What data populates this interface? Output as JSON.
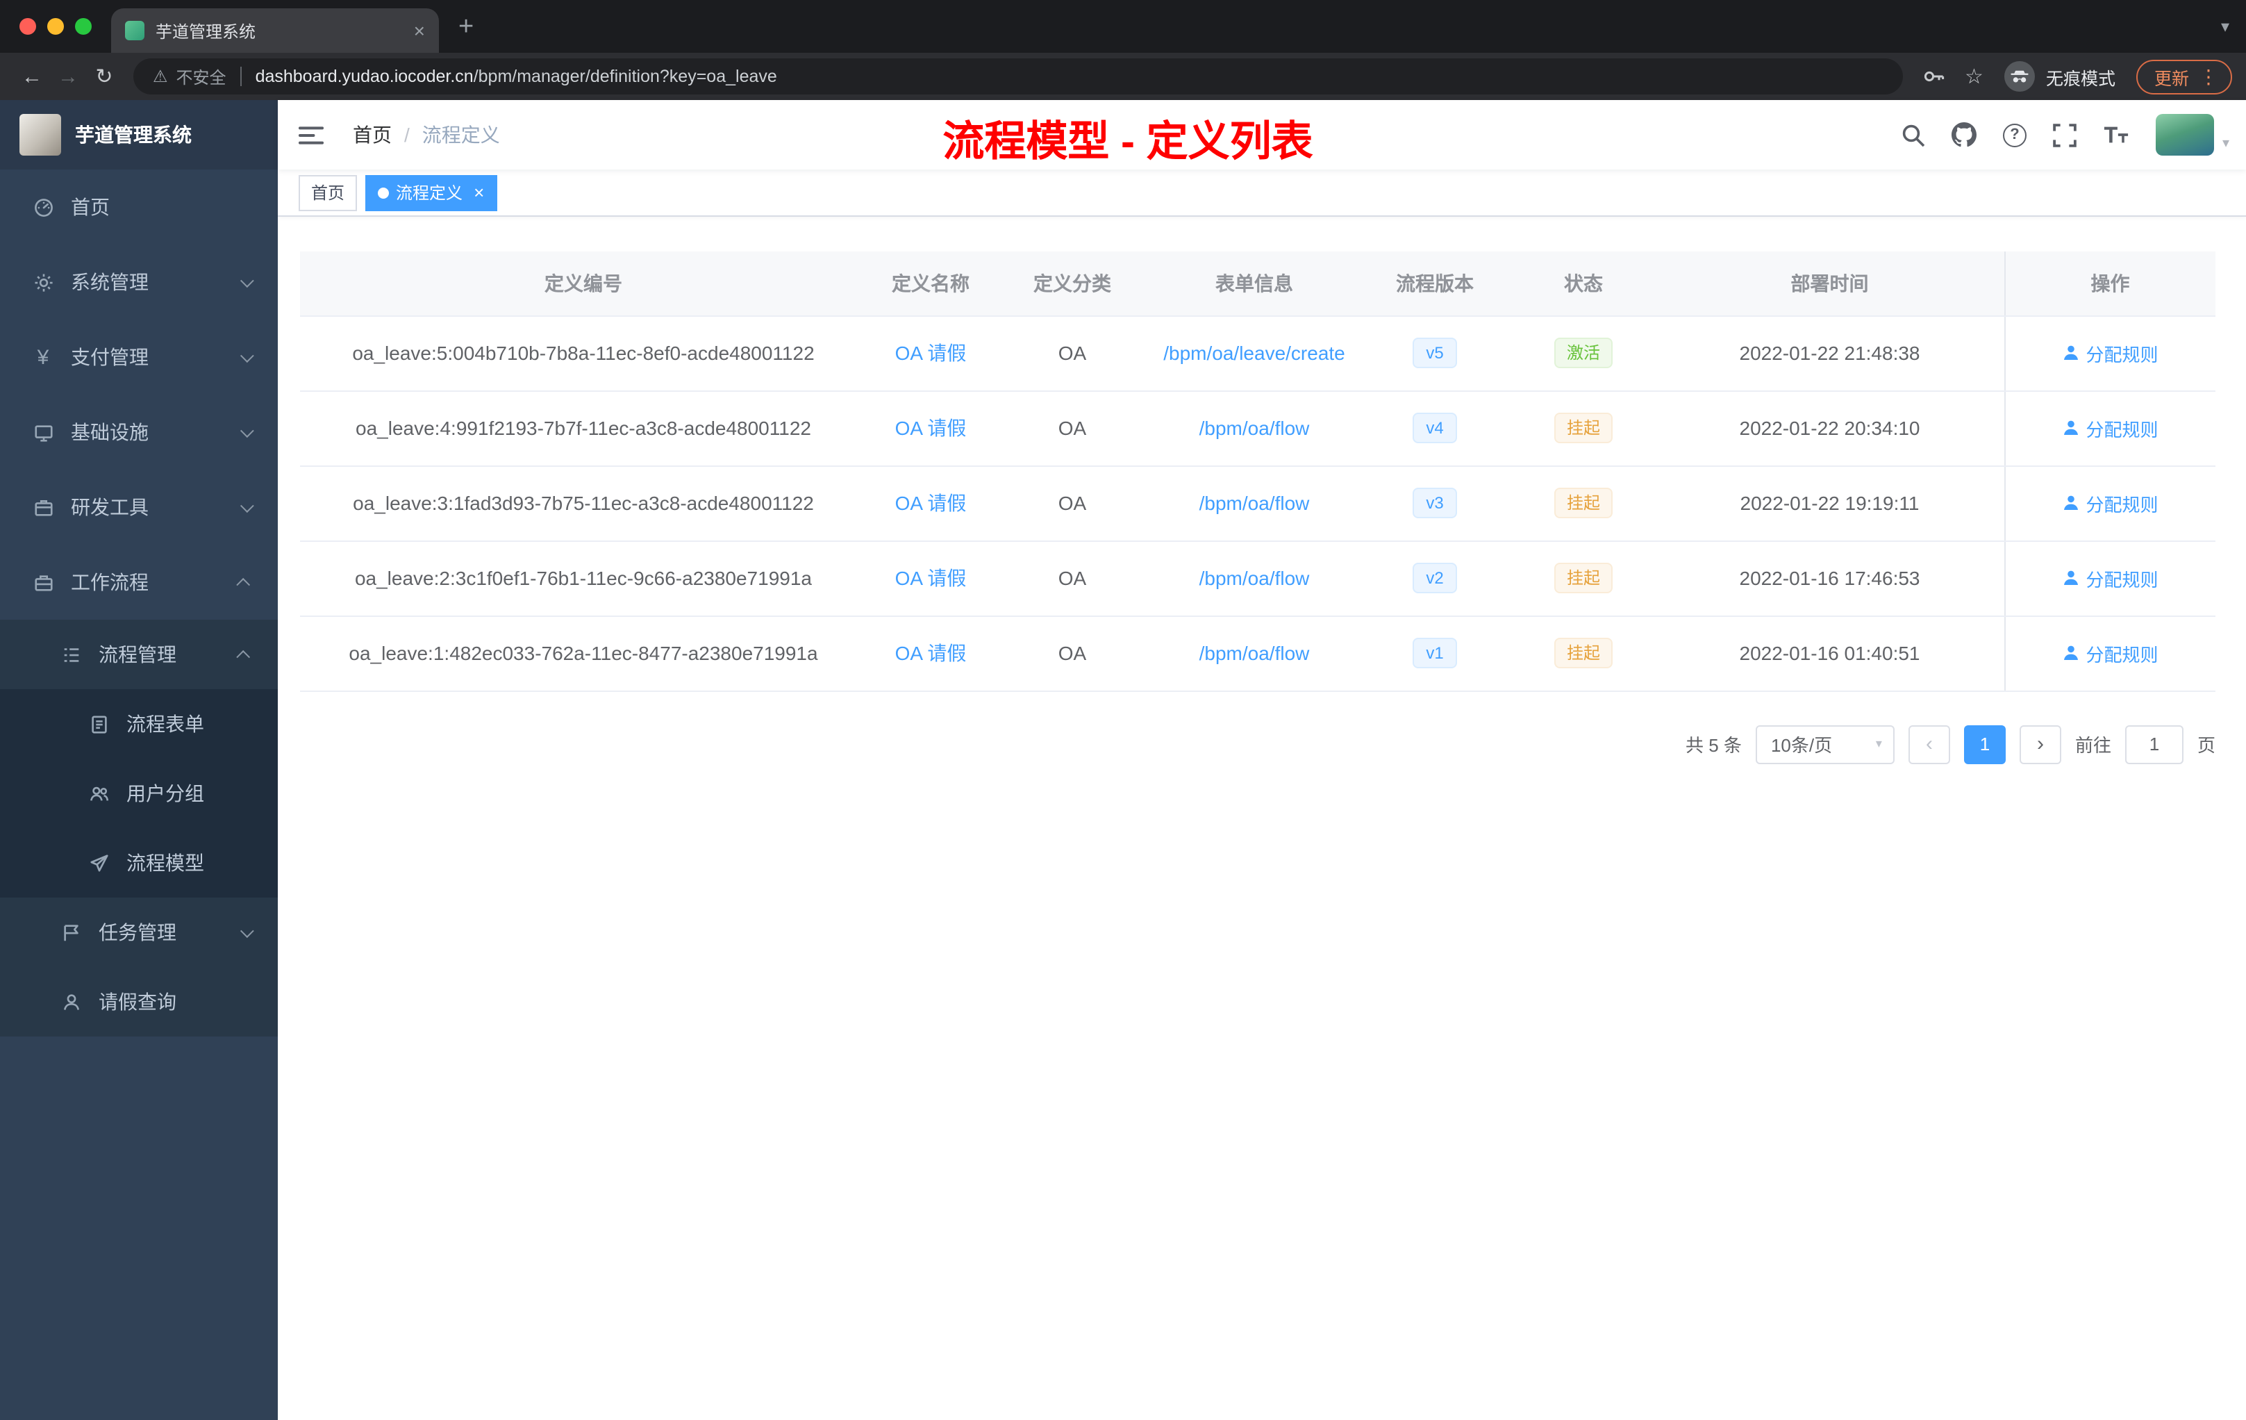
{
  "colors": {
    "accent": "#409eff",
    "success": "#67c23a",
    "warning": "#e6a23c",
    "annotation_red": "#fe0000",
    "sidebar_bg": "#304156"
  },
  "icons": {
    "back": "←",
    "forward": "→",
    "reload": "↻",
    "star": "☆",
    "warning": "⚠",
    "plus": "+",
    "close": "×",
    "chevron_down": "▾",
    "caret_down": "▾",
    "dots": "⋮",
    "question": "?",
    "prev": "‹",
    "next": "›",
    "yen": "¥"
  },
  "browser": {
    "tab_title": "芋道管理系统",
    "security_label": "不安全",
    "url_host": "dashboard.yudao.iocoder.cn",
    "url_path": "/bpm/manager/definition?key=oa_leave",
    "incognito_label": "无痕模式",
    "update_label": "更新"
  },
  "sidebar": {
    "logo_title": "芋道管理系统",
    "items": {
      "home": "首页",
      "system": "系统管理",
      "payment": "支付管理",
      "infra": "基础设施",
      "devtools": "研发工具",
      "workflow": "工作流程",
      "process_mgmt": "流程管理",
      "process_form": "流程表单",
      "user_group": "用户分组",
      "process_model": "流程模型",
      "task_mgmt": "任务管理",
      "leave_query": "请假查询"
    }
  },
  "navbar": {
    "breadcrumb_home": "首页",
    "breadcrumb_sep": "/",
    "breadcrumb_current": "流程定义",
    "annotation": "流程模型 - 定义列表"
  },
  "tags": {
    "home": "首页",
    "current": "流程定义"
  },
  "table": {
    "columns": [
      "定义编号",
      "定义名称",
      "定义分类",
      "表单信息",
      "流程版本",
      "状态",
      "部署时间",
      "操作"
    ],
    "rows": [
      {
        "id": "oa_leave:5:004b710b-7b8a-11ec-8ef0-acde48001122",
        "name": "OA 请假",
        "category": "OA",
        "form": "/bpm/oa/leave/create",
        "version": "v5",
        "status": "激活",
        "time": "2022-01-22 21:48:38",
        "action": "分配规则"
      },
      {
        "id": "oa_leave:4:991f2193-7b7f-11ec-a3c8-acde48001122",
        "name": "OA 请假",
        "category": "OA",
        "form": "/bpm/oa/flow",
        "version": "v4",
        "status": "挂起",
        "time": "2022-01-22 20:34:10",
        "action": "分配规则"
      },
      {
        "id": "oa_leave:3:1fad3d93-7b75-11ec-a3c8-acde48001122",
        "name": "OA 请假",
        "category": "OA",
        "form": "/bpm/oa/flow",
        "version": "v3",
        "status": "挂起",
        "time": "2022-01-22 19:19:11",
        "action": "分配规则"
      },
      {
        "id": "oa_leave:2:3c1f0ef1-76b1-11ec-9c66-a2380e71991a",
        "name": "OA 请假",
        "category": "OA",
        "form": "/bpm/oa/flow",
        "version": "v2",
        "status": "挂起",
        "time": "2022-01-16 17:46:53",
        "action": "分配规则"
      },
      {
        "id": "oa_leave:1:482ec033-762a-11ec-8477-a2380e71991a",
        "name": "OA 请假",
        "category": "OA",
        "form": "/bpm/oa/flow",
        "version": "v1",
        "status": "挂起",
        "time": "2022-01-16 01:40:51",
        "action": "分配规则"
      }
    ]
  },
  "pagination": {
    "total": "共 5 条",
    "page_size": "10条/页",
    "page": "1",
    "goto_label": "前往",
    "goto_value": "1",
    "unit_label": "页"
  }
}
